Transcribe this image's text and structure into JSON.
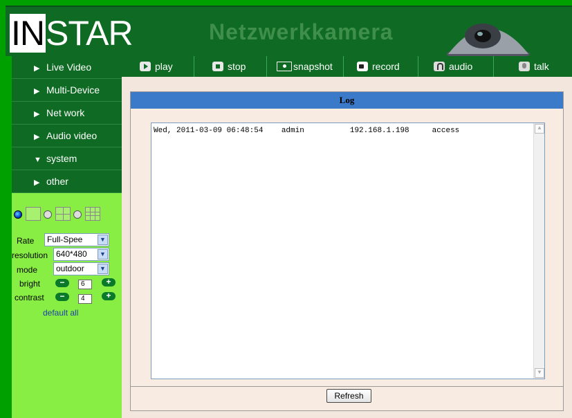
{
  "header": {
    "logo_black": "IN",
    "logo_white": "STAR",
    "title": "Netzwerkkamera"
  },
  "sidebar": {
    "items": [
      {
        "label": "Live Video",
        "arrow": "▶"
      },
      {
        "label": "Multi-Device",
        "arrow": "▶"
      },
      {
        "label": "Net work",
        "arrow": "▶"
      },
      {
        "label": "Audio video",
        "arrow": "▶"
      },
      {
        "label": "system",
        "arrow": "▼"
      },
      {
        "label": "other",
        "arrow": "▶"
      }
    ],
    "controls": {
      "rate_label": "Rate",
      "rate_value": "Full-Spee",
      "resolution_label": "resolution",
      "resolution_value": "640*480",
      "mode_label": "mode",
      "mode_value": "outdoor",
      "bright_label": "bright",
      "bright_value": "6",
      "contrast_label": "contrast",
      "contrast_value": "4",
      "minus": "−",
      "plus": "+",
      "default_all": "default all"
    }
  },
  "toolbar": {
    "play": "play",
    "stop": "stop",
    "snapshot": "snapshot",
    "record": "record",
    "audio": "audio",
    "talk": "talk"
  },
  "log": {
    "title": "Log",
    "entry": "Wed, 2011-03-09 06:48:54    admin          192.168.1.198     access",
    "refresh": "Refresh"
  },
  "icons": {
    "scroll_up": "▲",
    "scroll_down": "▼",
    "dropdown": "▼"
  },
  "colors": {
    "accent_green": "#0f6b24",
    "sidebar_bg": "#88ee44",
    "log_header": "#3a7ac8"
  }
}
